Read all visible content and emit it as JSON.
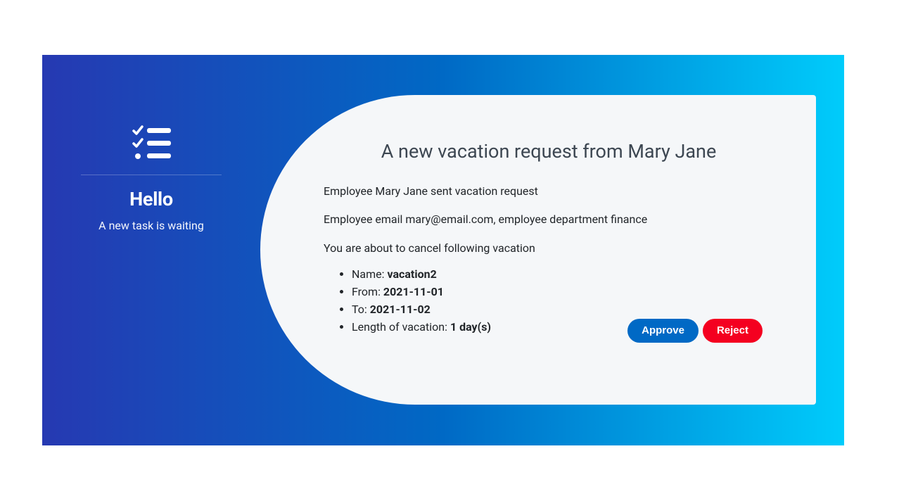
{
  "sidebar": {
    "greeting": "Hello",
    "subtitle": "A new task is waiting"
  },
  "content": {
    "title": "A new vacation request from Mary Jane",
    "line1": "Employee Mary Jane sent vacation request",
    "line2": "Employee email mary@email.com, employee department finance",
    "line3": "You are about to cancel following vacation",
    "details": {
      "name_label": "Name: ",
      "name_value": "vacation2",
      "from_label": "From: ",
      "from_value": "2021-11-01",
      "to_label": "To: ",
      "to_value": "2021-11-02",
      "length_label": "Length of vacation: ",
      "length_value": "1 day(s)"
    }
  },
  "buttons": {
    "approve": "Approve",
    "reject": "Reject"
  }
}
